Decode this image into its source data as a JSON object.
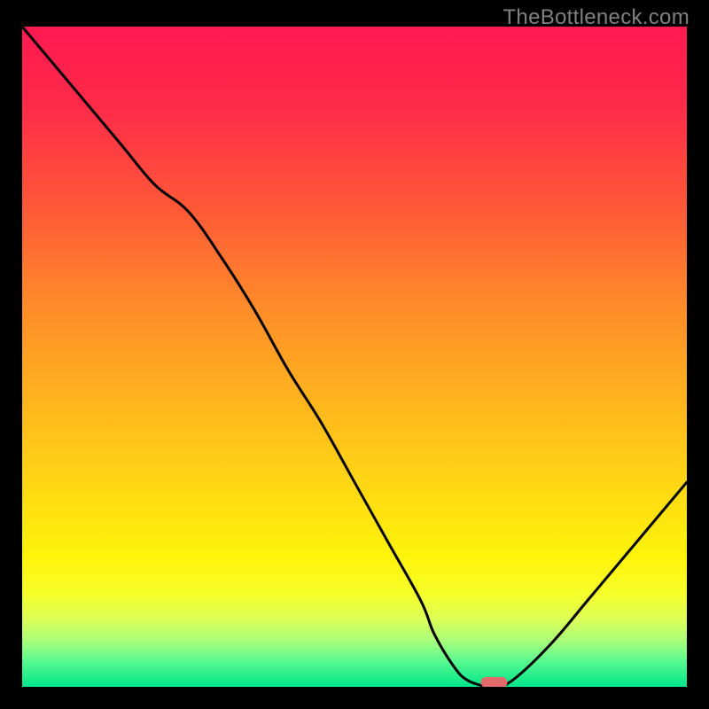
{
  "watermark": "TheBottleneck.com",
  "chart_data": {
    "type": "line",
    "title": "",
    "xlabel": "",
    "ylabel": "",
    "xlim": [
      0,
      100
    ],
    "ylim": [
      0,
      100
    ],
    "x": [
      0,
      5,
      10,
      15,
      20,
      25,
      30,
      35,
      40,
      45,
      50,
      55,
      60,
      62,
      65,
      67,
      70,
      72,
      75,
      80,
      85,
      90,
      95,
      100
    ],
    "values": [
      100,
      94,
      88,
      82,
      76,
      72,
      65,
      57,
      48,
      40,
      31,
      22,
      13,
      8,
      3,
      1,
      0,
      0,
      2,
      7,
      13,
      19,
      25,
      31
    ],
    "marker": {
      "x": 71,
      "y": 0,
      "width": 4,
      "height": 1.5
    },
    "gradient_stops": [
      {
        "offset": 0.0,
        "color": "#ff1951"
      },
      {
        "offset": 0.12,
        "color": "#ff2a49"
      },
      {
        "offset": 0.28,
        "color": "#ff5a37"
      },
      {
        "offset": 0.42,
        "color": "#ff8a2a"
      },
      {
        "offset": 0.56,
        "color": "#ffb21e"
      },
      {
        "offset": 0.7,
        "color": "#ffd913"
      },
      {
        "offset": 0.8,
        "color": "#fff30a"
      },
      {
        "offset": 0.86,
        "color": "#f6ff2a"
      },
      {
        "offset": 0.9,
        "color": "#d9ff5a"
      },
      {
        "offset": 0.93,
        "color": "#aaff7a"
      },
      {
        "offset": 0.96,
        "color": "#5cfa90"
      },
      {
        "offset": 1.0,
        "color": "#00e68a"
      }
    ],
    "marker_color": "#e46a6a",
    "line_color": "#000000"
  }
}
